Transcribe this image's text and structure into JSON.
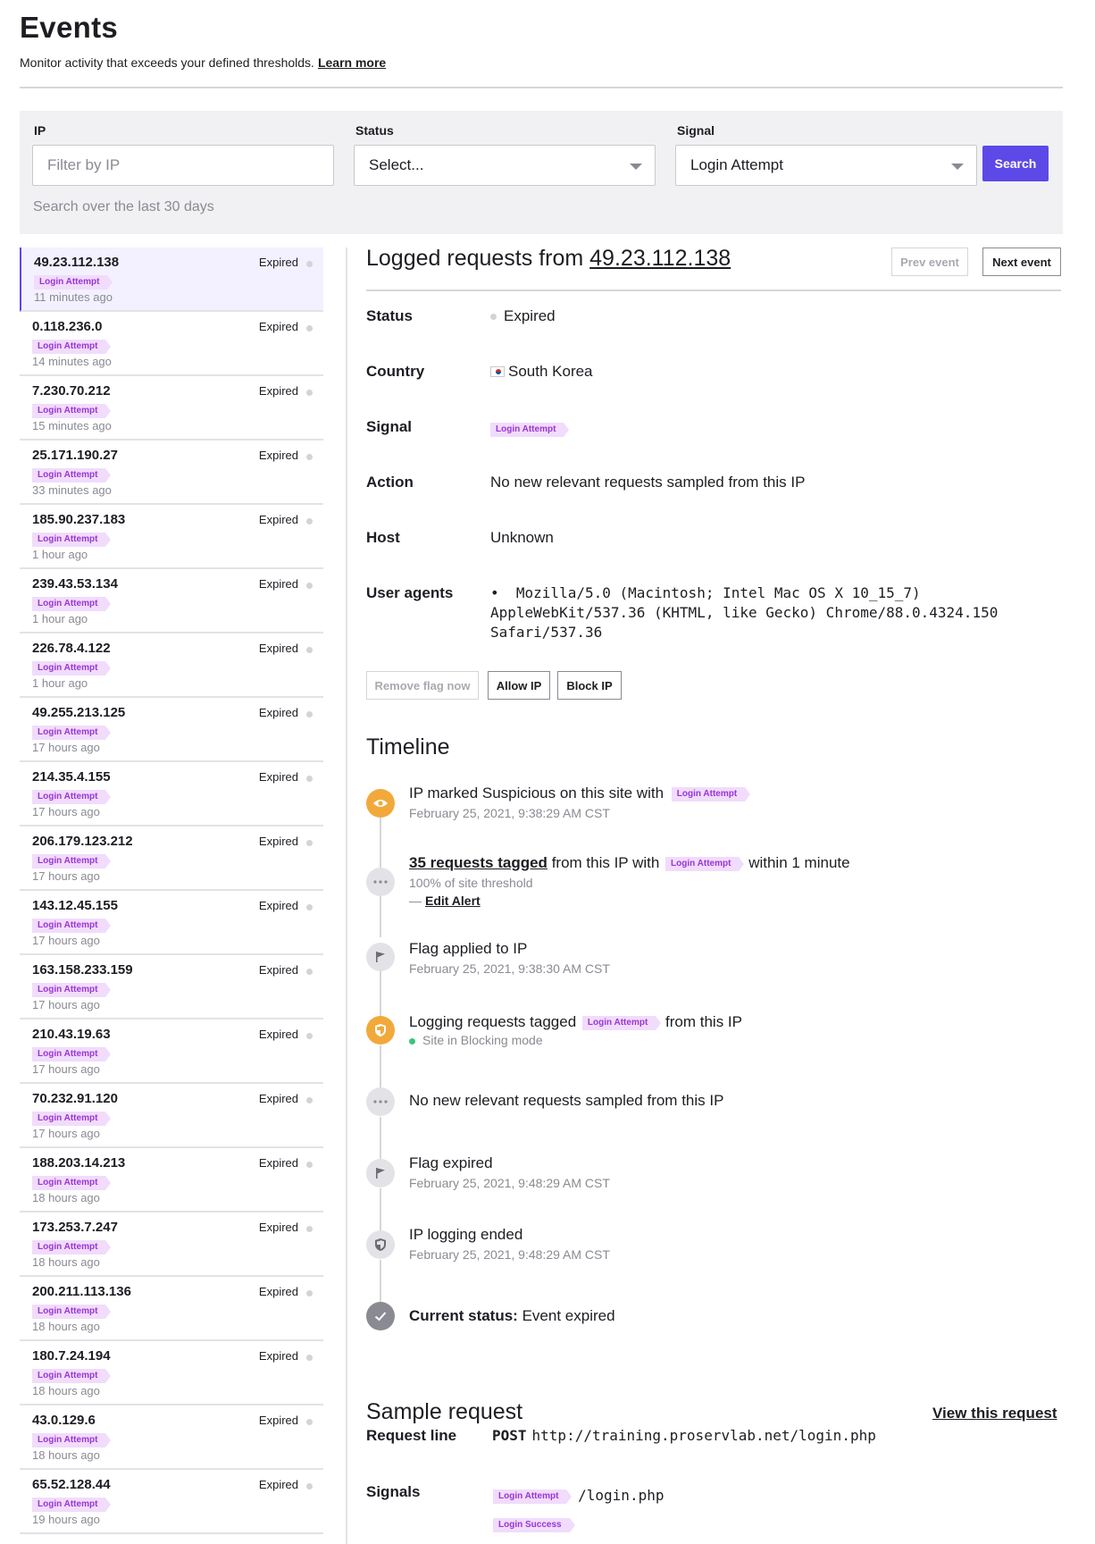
{
  "header": {
    "title": "Events",
    "subtitle": "Monitor activity that exceeds your defined thresholds.",
    "learn_more": "Learn more"
  },
  "filters": {
    "ip_label": "IP",
    "ip_placeholder": "Filter by IP",
    "status_label": "Status",
    "status_value": "Select...",
    "signal_label": "Signal",
    "signal_value": "Login Attempt",
    "search_label": "Search",
    "hint": "Search over the last 30 days"
  },
  "events": [
    {
      "ip": "49.23.112.138",
      "status": "Expired",
      "signal": "Login Attempt",
      "time": "11 minutes ago"
    },
    {
      "ip": "0.118.236.0",
      "status": "Expired",
      "signal": "Login Attempt",
      "time": "14 minutes ago"
    },
    {
      "ip": "7.230.70.212",
      "status": "Expired",
      "signal": "Login Attempt",
      "time": "15 minutes ago"
    },
    {
      "ip": "25.171.190.27",
      "status": "Expired",
      "signal": "Login Attempt",
      "time": "33 minutes ago"
    },
    {
      "ip": "185.90.237.183",
      "status": "Expired",
      "signal": "Login Attempt",
      "time": "1 hour ago"
    },
    {
      "ip": "239.43.53.134",
      "status": "Expired",
      "signal": "Login Attempt",
      "time": "1 hour ago"
    },
    {
      "ip": "226.78.4.122",
      "status": "Expired",
      "signal": "Login Attempt",
      "time": "1 hour ago"
    },
    {
      "ip": "49.255.213.125",
      "status": "Expired",
      "signal": "Login Attempt",
      "time": "17 hours ago"
    },
    {
      "ip": "214.35.4.155",
      "status": "Expired",
      "signal": "Login Attempt",
      "time": "17 hours ago"
    },
    {
      "ip": "206.179.123.212",
      "status": "Expired",
      "signal": "Login Attempt",
      "time": "17 hours ago"
    },
    {
      "ip": "143.12.45.155",
      "status": "Expired",
      "signal": "Login Attempt",
      "time": "17 hours ago"
    },
    {
      "ip": "163.158.233.159",
      "status": "Expired",
      "signal": "Login Attempt",
      "time": "17 hours ago"
    },
    {
      "ip": "210.43.19.63",
      "status": "Expired",
      "signal": "Login Attempt",
      "time": "17 hours ago"
    },
    {
      "ip": "70.232.91.120",
      "status": "Expired",
      "signal": "Login Attempt",
      "time": "17 hours ago"
    },
    {
      "ip": "188.203.14.213",
      "status": "Expired",
      "signal": "Login Attempt",
      "time": "18 hours ago"
    },
    {
      "ip": "173.253.7.247",
      "status": "Expired",
      "signal": "Login Attempt",
      "time": "18 hours ago"
    },
    {
      "ip": "200.211.113.136",
      "status": "Expired",
      "signal": "Login Attempt",
      "time": "18 hours ago"
    },
    {
      "ip": "180.7.24.194",
      "status": "Expired",
      "signal": "Login Attempt",
      "time": "18 hours ago"
    },
    {
      "ip": "43.0.129.6",
      "status": "Expired",
      "signal": "Login Attempt",
      "time": "18 hours ago"
    },
    {
      "ip": "65.52.128.44",
      "status": "Expired",
      "signal": "Login Attempt",
      "time": "19 hours ago"
    }
  ],
  "detail": {
    "title_prefix": "Logged requests from",
    "ip": "49.23.112.138",
    "prev_label": "Prev event",
    "next_label": "Next event",
    "status_label": "Status",
    "status_value": "Expired",
    "country_label": "Country",
    "country_value": "South Korea",
    "signal_label": "Signal",
    "signal_value": "Login Attempt",
    "action_label": "Action",
    "action_value": "No new relevant requests sampled from this IP",
    "host_label": "Host",
    "host_value": "Unknown",
    "ua_label": "User agents",
    "ua_line1": "•  Mozilla/5.0 (Macintosh; Intel Mac OS X 10_15_7)",
    "ua_line2": "AppleWebKit/537.36 (KHTML, like Gecko) Chrome/88.0.4324.150",
    "ua_line3": "Safari/537.36",
    "remove_flag_label": "Remove flag now",
    "allow_ip_label": "Allow IP",
    "block_ip_label": "Block IP"
  },
  "timeline": {
    "title": "Timeline",
    "e1_text": "IP marked Suspicious on this site with",
    "e1_tag": "Login Attempt",
    "e1_time": "February 25, 2021, 9:38:29 AM CST",
    "e2_link": "35 requests tagged",
    "e2_text_a": "from this IP with",
    "e2_tag": "Login Attempt",
    "e2_text_b": "within 1 minute",
    "e2_sub": "100% of site threshold",
    "e2_dash": "—",
    "e2_edit": "Edit Alert",
    "e3_text": "Flag applied to IP",
    "e3_time": "February 25, 2021, 9:38:30 AM CST",
    "e4_text_a": "Logging requests tagged",
    "e4_tag": "Login Attempt",
    "e4_text_b": "from this IP",
    "e4_sub": "Site in Blocking mode",
    "e5_text": "No new relevant requests sampled from this IP",
    "e6_text": "Flag expired",
    "e6_time": "February 25, 2021, 9:48:29 AM CST",
    "e7_text": "IP logging ended",
    "e7_time": "February 25, 2021, 9:48:29 AM CST",
    "current_label": "Current status:",
    "current_value": "Event expired"
  },
  "sample": {
    "title": "Sample request",
    "view_link": "View this request",
    "request_line_label": "Request line",
    "method": "POST",
    "url": "http://training.proservlab.net/login.php",
    "signals_label": "Signals",
    "signal1": "Login Attempt",
    "signal1_path": "/login.php",
    "signal2": "Login Success"
  }
}
